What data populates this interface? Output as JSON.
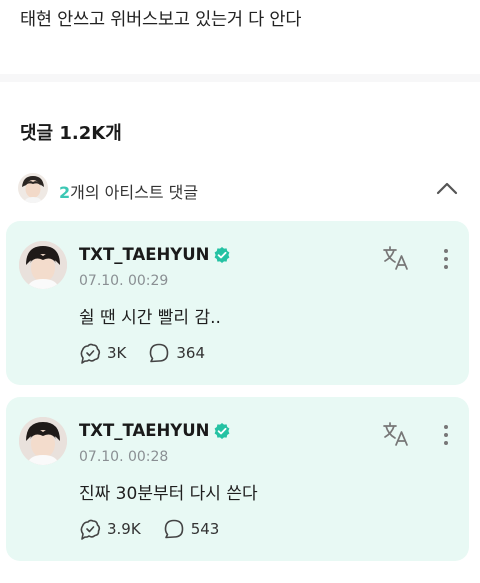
{
  "post": {
    "text": "태현 안쓰고 위버스보고 있는거 다 안다"
  },
  "comments": {
    "header": "댓글 1.2K개"
  },
  "artist_comments": {
    "count": "2",
    "label_suffix": "개의 아티스트 댓글",
    "collapse_icon": "chevron-up-icon"
  },
  "cards": [
    {
      "author": "TXT_TAEHYUN",
      "timestamp": "07.10. 00:29",
      "body": "쉴 땐 시간 빨리 감..",
      "likes": "3K",
      "replies": "364"
    },
    {
      "author": "TXT_TAEHYUN",
      "timestamp": "07.10. 00:28",
      "body": "진짜 30분부터 다시 쓴다",
      "likes": "3.9K",
      "replies": "543"
    }
  ],
  "colors": {
    "card_bg": "#e8f9f4",
    "accent": "#3cc7b4",
    "verified": "#25c2a3"
  }
}
